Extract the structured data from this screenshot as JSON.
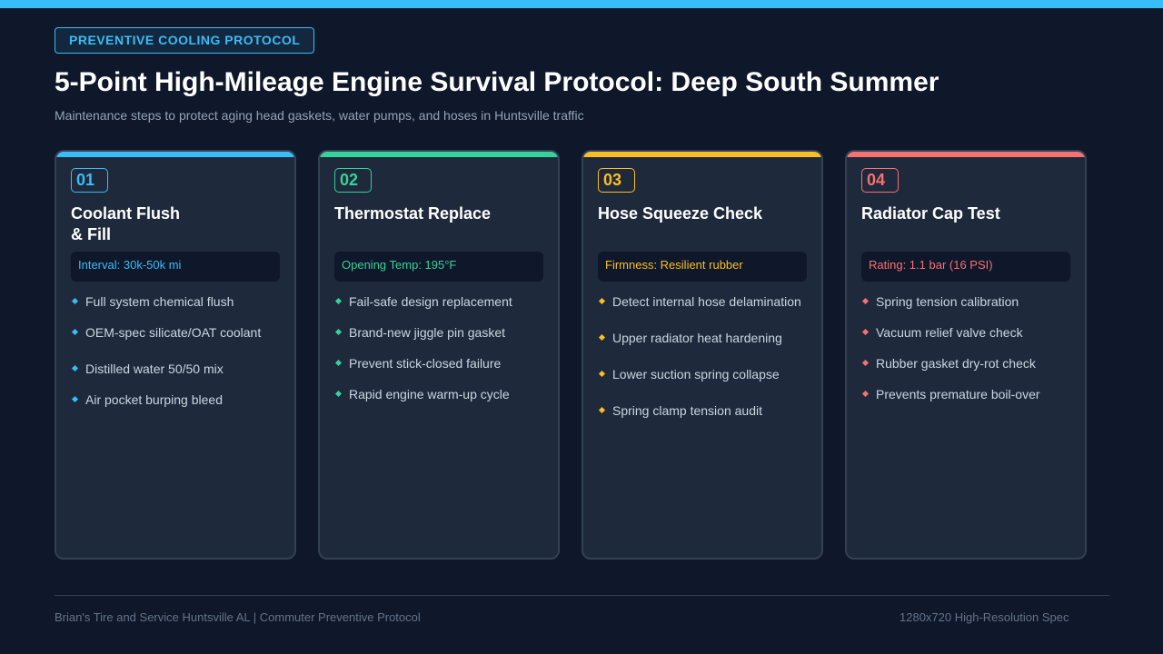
{
  "header": {
    "badge": "PREVENTIVE COOLING PROTOCOL",
    "title": "5-Point High-Mileage Engine Survival Protocol: Deep South Summer",
    "subtitle": "Maintenance steps to protect aging head gaskets, water pumps, and hoses in Huntsville traffic"
  },
  "cards": [
    {
      "number": "01",
      "title_line1": "Coolant Flush",
      "title_line2": "& Fill",
      "meta": "Interval: 30k-50k mi",
      "accent": "#38bdf8",
      "items": [
        "Full system chemical flush",
        "OEM-spec silicate/OAT coolant",
        "Distilled water 50/50 mix",
        "Air pocket burping bleed"
      ]
    },
    {
      "number": "02",
      "title": "Thermostat Replace",
      "meta": "Opening Temp: 195°F",
      "accent": "#34d399",
      "items": [
        "Fail-safe design replacement",
        "Brand-new jiggle pin gasket",
        "Prevent stick-closed failure",
        "Rapid engine warm-up cycle"
      ]
    },
    {
      "number": "03",
      "title": "Hose Squeeze Check",
      "meta": "Firmness: Resilient rubber",
      "accent": "#fbbf24",
      "items": [
        "Detect internal hose delamination",
        "Upper radiator heat hardening",
        "Lower suction spring collapse",
        "Spring clamp tension audit"
      ]
    },
    {
      "number": "04",
      "title": "Radiator Cap Test",
      "meta": "Rating: 1.1 bar (16 PSI)",
      "accent": "#f87171",
      "items": [
        "Spring tension calibration",
        "Vacuum relief valve check",
        "Rubber gasket dry-rot check",
        "Prevents premature boil-over"
      ]
    }
  ],
  "footer": {
    "left": "Brian's Tire and Service Huntsville AL | Commuter Preventive Protocol",
    "right": "1280x720 High-Resolution Spec"
  }
}
